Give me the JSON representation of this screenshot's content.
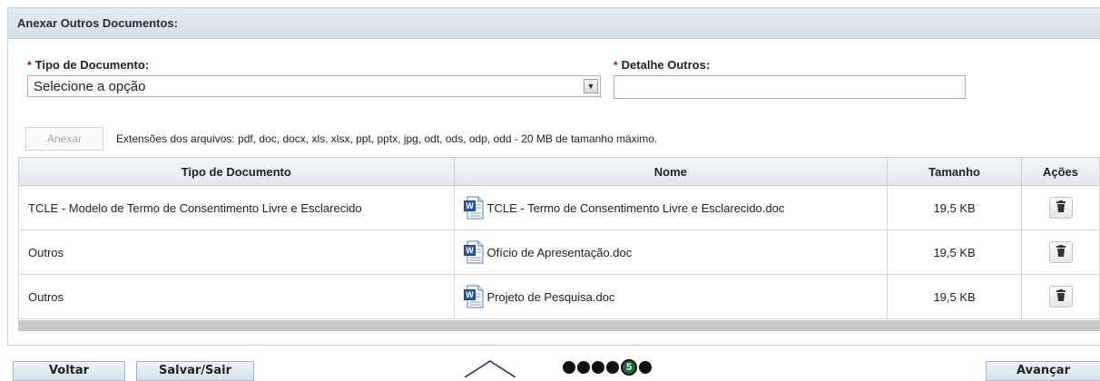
{
  "panel": {
    "title": "Anexar Outros Documentos:"
  },
  "form": {
    "required_mark": "*",
    "tipo_label": "Tipo de Documento:",
    "tipo_value": "Selecione a opção",
    "detalhe_label": "Detalhe Outros:",
    "detalhe_value": ""
  },
  "upload": {
    "button_label": "Anexar",
    "extensions_text": "Extensões dos arquivos: pdf, doc, docx, xls, xlsx, ppt, pptx, jpg, odt, ods, odp, odd - 20 MB de tamanho máximo."
  },
  "table": {
    "headers": [
      "Tipo de Documento",
      "Nome",
      "Tamanho",
      "Ações"
    ],
    "rows": [
      {
        "tipo": "TCLE - Modelo de Termo de Consentimento Livre e Esclarecido",
        "nome": "TCLE - Termo de Consentimento Livre e Esclarecido.doc",
        "tamanho": "19,5 KB",
        "file_icon": "word-doc-icon",
        "action_icon": "trash-icon"
      },
      {
        "tipo": "Outros",
        "nome": "Ofício de Apresentação.doc",
        "tamanho": "19,5 KB",
        "file_icon": "word-doc-icon",
        "action_icon": "trash-icon"
      },
      {
        "tipo": "Outros",
        "nome": "Projeto de Pesquisa.doc",
        "tamanho": "19,5 KB",
        "file_icon": "word-doc-icon",
        "action_icon": "trash-icon"
      }
    ]
  },
  "footer": {
    "voltar_label": "Voltar",
    "salvar_label": "Salvar/Sair",
    "avancar_label": "Avançar",
    "current_step": "5"
  },
  "colors": {
    "required": "#d00000",
    "header_bg": "#dde5ed",
    "step_current": "#1d6b2e"
  }
}
